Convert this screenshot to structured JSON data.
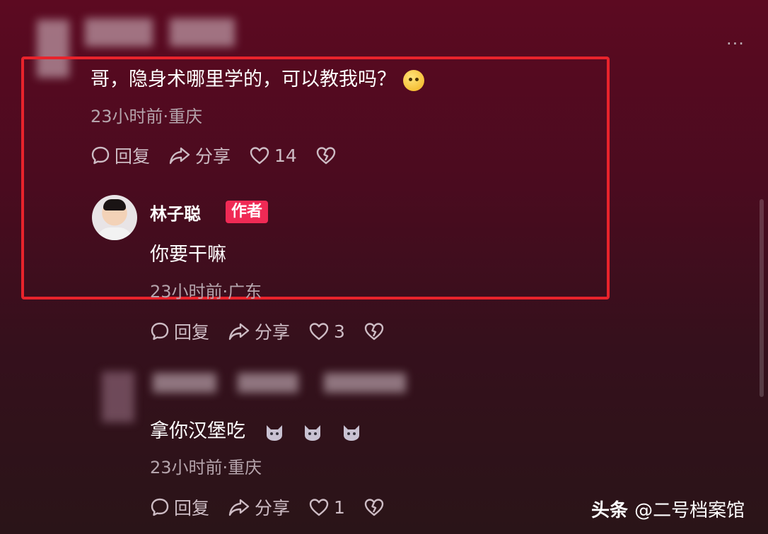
{
  "comments": {
    "top": {
      "text": "哥，隐身术哪里学的，可以教我吗？",
      "meta": "23小时前·重庆",
      "reply_label": "回复",
      "share_label": "分享",
      "like_count": "14"
    },
    "author_reply": {
      "author": "林子聪",
      "badge": "作者",
      "text": "你要干嘛",
      "meta": "23小时前·广东",
      "reply_label": "回复",
      "share_label": "分享",
      "like_count": "3"
    },
    "second_reply": {
      "text": "拿你汉堡吃",
      "meta": "23小时前·重庆",
      "reply_label": "回复",
      "share_label": "分享",
      "like_count": "1"
    }
  },
  "watermark": {
    "brand": "头条",
    "account": "@二号档案馆"
  },
  "icons": {
    "more": "more-icon",
    "reply": "comment-bubble-icon",
    "share": "share-arrow-icon",
    "like": "heart-icon",
    "dislike": "broken-heart-icon"
  },
  "colors": {
    "highlight_border": "#e8232b",
    "author_badge": "#f02a55"
  }
}
